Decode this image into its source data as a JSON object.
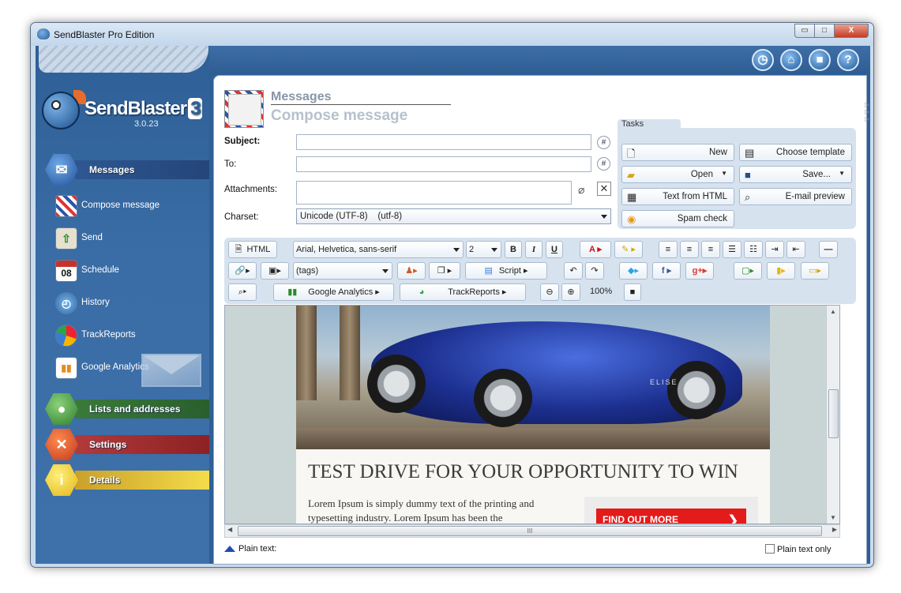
{
  "window": {
    "title": "SendBlaster Pro Edition",
    "minimize": "▭",
    "maximize": "□",
    "close": "X"
  },
  "topbar": {
    "icons": [
      "clock-icon",
      "home-icon",
      "video-icon",
      "help-icon"
    ],
    "help_glyph": "?"
  },
  "logo": {
    "name": "SendBlaster",
    "version_mark": "3",
    "version": "3.0.23"
  },
  "sidebar": {
    "categories": [
      {
        "label": "Messages",
        "color": "#2e5791"
      },
      {
        "label": "Lists and addresses",
        "color": "#2f6e37"
      },
      {
        "label": "Settings",
        "color": "#9b2326"
      },
      {
        "label": "Details",
        "color": "#e8c92c"
      }
    ],
    "items": [
      {
        "label": "Compose message",
        "icon": "compose-icon"
      },
      {
        "label": "Send",
        "icon": "send-icon"
      },
      {
        "label": "Schedule",
        "icon": "calendar-icon",
        "glyph": "08"
      },
      {
        "label": "History",
        "icon": "history-icon"
      },
      {
        "label": "TrackReports",
        "icon": "trackreports-icon"
      },
      {
        "label": "Google Analytics",
        "icon": "analytics-icon"
      }
    ]
  },
  "header": {
    "section": "Messages",
    "page": "Compose message"
  },
  "form": {
    "subject_label": "Subject:",
    "to_label": "To:",
    "attachments_label": "Attachments:",
    "charset_label": "Charset:",
    "charset_value": "Unicode (UTF-8)    (utf-8)",
    "hash": "#"
  },
  "tasks": {
    "title": "Tasks",
    "buttons": {
      "new": "New",
      "choose_template": "Choose template",
      "open": "Open",
      "save": "Save...",
      "text_from_html": "Text from HTML",
      "email_preview": "E-mail preview",
      "spam_check": "Spam check"
    }
  },
  "toolbar": {
    "html": "HTML",
    "font": "Arial, Helvetica, sans-serif",
    "size": "2",
    "bold": "B",
    "italic": "I",
    "underline": "U",
    "tags": "(tags)",
    "script": "Script",
    "google_analytics": "Google Analytics",
    "trackreports": "TrackReports",
    "zoom": "100%"
  },
  "newsletter": {
    "heading": "TEST DRIVE FOR YOUR OPPORTUNITY TO WIN",
    "body": "Lorem Ipsum is simply dummy text of the printing and typesetting industry. Lorem Ipsum has been the",
    "cta": "FIND OUT MORE",
    "car_badge": "ELISE"
  },
  "footer": {
    "plain_text": "Plain text:",
    "plain_text_only": "Plain text only",
    "scroll_grip": "III"
  }
}
